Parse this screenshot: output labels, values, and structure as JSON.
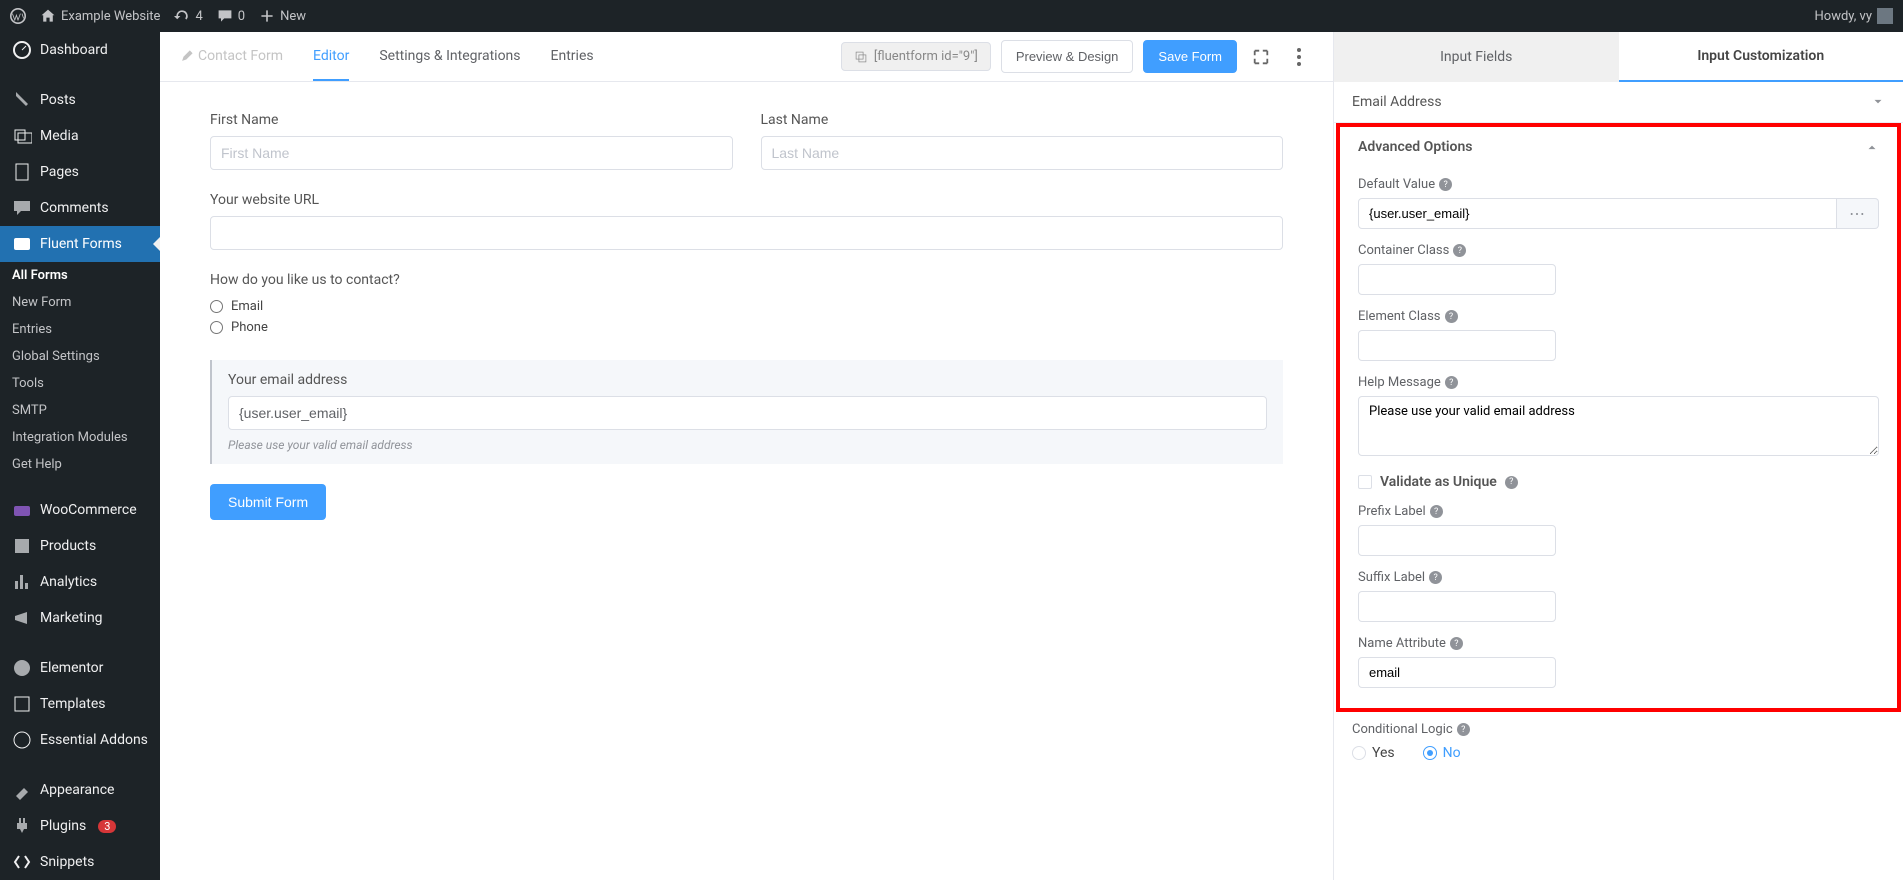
{
  "adminbar": {
    "site_name": "Example Website",
    "updates": "4",
    "comments": "0",
    "new": "New",
    "howdy": "Howdy, vy"
  },
  "sidebar": {
    "dashboard": "Dashboard",
    "posts": "Posts",
    "media": "Media",
    "pages": "Pages",
    "comments": "Comments",
    "fluent_forms": "Fluent Forms",
    "sub": {
      "all_forms": "All Forms",
      "new_form": "New Form",
      "entries": "Entries",
      "global_settings": "Global Settings",
      "tools": "Tools",
      "smtp": "SMTP",
      "integration_modules": "Integration Modules",
      "get_help": "Get Help"
    },
    "woocommerce": "WooCommerce",
    "products": "Products",
    "analytics": "Analytics",
    "marketing": "Marketing",
    "elementor": "Elementor",
    "templates": "Templates",
    "essential_addons": "Essential Addons",
    "appearance": "Appearance",
    "plugins": "Plugins",
    "plugins_badge": "3",
    "snippets": "Snippets"
  },
  "tabs": {
    "contact_form": "Contact Form",
    "editor": "Editor",
    "settings": "Settings & Integrations",
    "entries": "Entries",
    "shortcode": "[fluentform id=\"9\"]",
    "preview": "Preview & Design",
    "save": "Save Form"
  },
  "form": {
    "first_name": {
      "label": "First Name",
      "placeholder": "First Name"
    },
    "last_name": {
      "label": "Last Name",
      "placeholder": "Last Name"
    },
    "url": {
      "label": "Your website URL"
    },
    "contact_q": "How do you like us to contact?",
    "opt_email": "Email",
    "opt_phone": "Phone",
    "email_label": "Your email address",
    "email_value": "{user.user_email}",
    "email_help": "Please use your valid email address",
    "submit": "Submit Form"
  },
  "panel": {
    "tab_fields": "Input Fields",
    "tab_custom": "Input Customization",
    "section_email": "Email Address",
    "section_advanced": "Advanced Options",
    "default_value": {
      "label": "Default Value",
      "value": "{user.user_email}"
    },
    "container_class": "Container Class",
    "element_class": "Element Class",
    "help_message": {
      "label": "Help Message",
      "value": "Please use your valid email address"
    },
    "validate_unique": "Validate as Unique",
    "prefix_label": "Prefix Label",
    "suffix_label": "Suffix Label",
    "name_attr": {
      "label": "Name Attribute",
      "value": "email"
    },
    "cond_logic": "Conditional Logic",
    "yes": "Yes",
    "no": "No"
  }
}
